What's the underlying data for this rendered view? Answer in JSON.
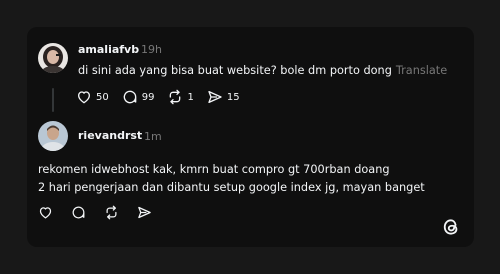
{
  "colors": {
    "background": "#181818",
    "card": "#0f0f0f",
    "text": "#f3f5f7",
    "muted": "#777777"
  },
  "post": {
    "username": "amaliafvb",
    "time": "19h",
    "text": "di sini ada yang bisa buat website? bole dm porto dong",
    "translate_label": "Translate",
    "likes": "50",
    "replies": "99",
    "reposts": "1",
    "shares": "15",
    "icons": [
      "heart-icon",
      "comment-icon",
      "repost-icon",
      "share-icon"
    ]
  },
  "reply": {
    "username": "rievandrst",
    "time": "1m",
    "text_lines": [
      "rekomen idwebhost kak, kmrn buat compro gt 700rban doang",
      "2 hari pengerjaan dan dibantu setup google index jg, mayan banget"
    ],
    "icons": [
      "heart-icon",
      "comment-icon",
      "repost-icon",
      "share-icon"
    ]
  },
  "app": {
    "logo_icon": "threads-logo-icon"
  }
}
